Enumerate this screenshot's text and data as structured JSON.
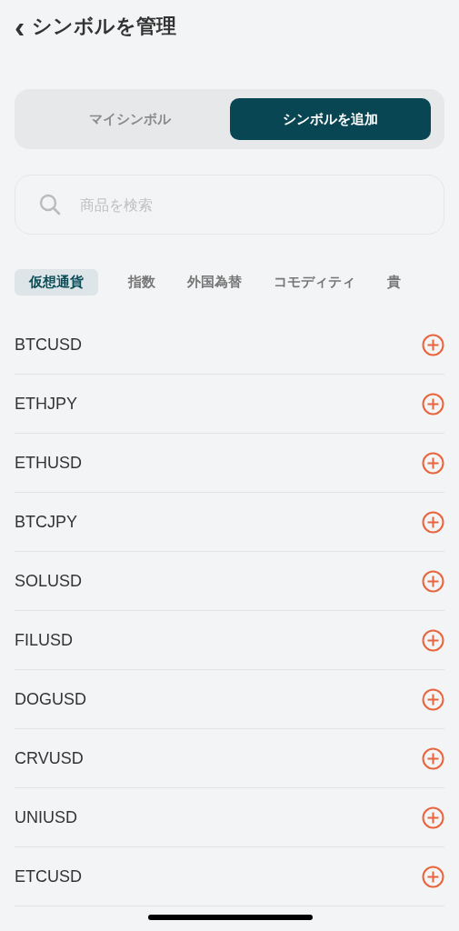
{
  "header": {
    "back": "‹",
    "title": "シンボルを管理"
  },
  "segments": [
    {
      "label": "マイシンボル",
      "selected": false
    },
    {
      "label": "シンボルを追加",
      "selected": true
    }
  ],
  "search": {
    "placeholder": "商品を検索"
  },
  "categories": [
    {
      "label": "仮想通貨",
      "selected": true
    },
    {
      "label": "指数",
      "selected": false
    },
    {
      "label": "外国為替",
      "selected": false
    },
    {
      "label": "コモディティ",
      "selected": false
    },
    {
      "label": "貴",
      "selected": false
    }
  ],
  "symbols": [
    {
      "name": "BTCUSD"
    },
    {
      "name": "ETHJPY"
    },
    {
      "name": "ETHUSD"
    },
    {
      "name": "BTCJPY"
    },
    {
      "name": "SOLUSD"
    },
    {
      "name": "FILUSD"
    },
    {
      "name": "DOGUSD"
    },
    {
      "name": "CRVUSD"
    },
    {
      "name": "UNIUSD"
    },
    {
      "name": "ETCUSD"
    }
  ]
}
